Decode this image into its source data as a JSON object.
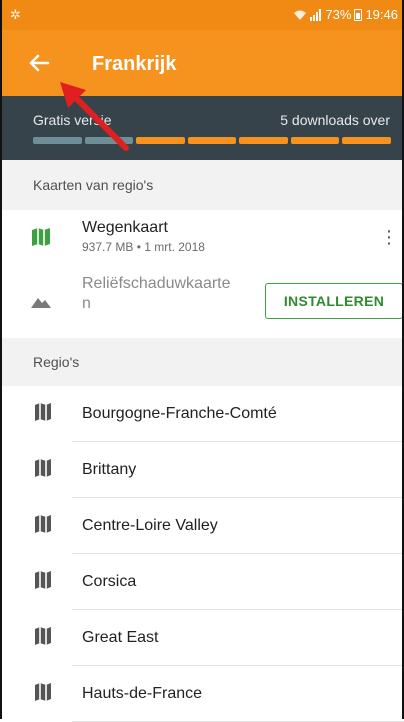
{
  "status_bar": {
    "battery_percent": "73%",
    "time": "19:46"
  },
  "app_bar": {
    "title": "Frankrijk",
    "back_icon": "arrow-left-icon"
  },
  "download_banner": {
    "left_text": "Gratis versie",
    "right_text": "5 downloads over",
    "segments_total": 7,
    "segments_used": 2,
    "colors": {
      "used": "#6c8f98",
      "remaining": "#f6921e"
    }
  },
  "maps_section": {
    "header": "Kaarten van regio's",
    "items": [
      {
        "name": "Wegenkaart",
        "details": "937.7 MB • 1 mrt. 2018",
        "icon": "map-icon",
        "state": "installed"
      },
      {
        "name": "Reliëfschaduwkaarte\nn",
        "icon": "mountain-icon",
        "state": "available",
        "action_label": "INSTALLEREN"
      }
    ]
  },
  "regions_section": {
    "header": "Regio's",
    "items": [
      {
        "label": "Bourgogne-Franche-Comté",
        "icon": "map-outline-icon"
      },
      {
        "label": "Brittany",
        "icon": "map-outline-icon"
      },
      {
        "label": "Centre-Loire Valley",
        "icon": "map-outline-icon"
      },
      {
        "label": "Corsica",
        "icon": "map-outline-icon"
      },
      {
        "label": "Great East",
        "icon": "map-outline-icon"
      },
      {
        "label": "Hauts-de-France",
        "icon": "map-outline-icon"
      }
    ]
  },
  "colors": {
    "accent": "#f6921e",
    "dark_bar": "#37434a",
    "installed_green": "#3ea040",
    "annotation_arrow": "#e02020"
  }
}
